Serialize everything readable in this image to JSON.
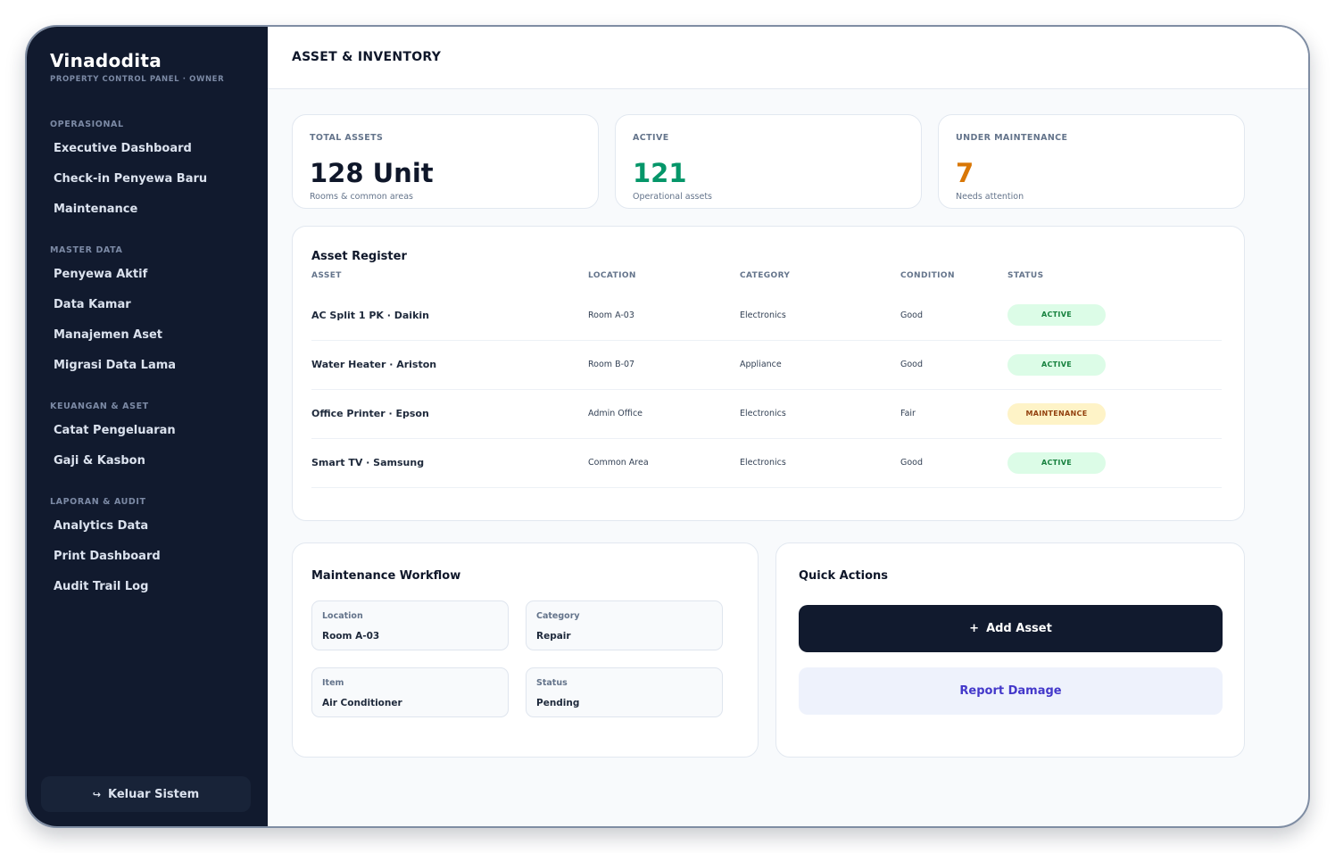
{
  "brand": {
    "title": "Vinadodita",
    "subtitle": "PROPERTY CONTROL PANEL · OWNER"
  },
  "sidebar": {
    "sections": [
      {
        "heading": "OPERASIONAL",
        "items": [
          "Executive Dashboard",
          "Check-in Penyewa Baru",
          "Maintenance"
        ]
      },
      {
        "heading": "MASTER DATA",
        "items": [
          "Penyewa Aktif",
          "Data Kamar",
          "Manajemen Aset",
          "Migrasi Data Lama"
        ]
      },
      {
        "heading": "KEUANGAN & ASET",
        "items": [
          "Catat Pengeluaran",
          "Gaji & Kasbon"
        ]
      },
      {
        "heading": "LAPORAN & AUDIT",
        "items": [
          "Analytics Data",
          "Print Dashboard",
          "Audit Trail Log"
        ]
      }
    ],
    "logout": {
      "icon": "↪",
      "label": "Keluar Sistem"
    }
  },
  "header": {
    "title": "ASSET & INVENTORY"
  },
  "stats": [
    {
      "label": "TOTAL ASSETS",
      "value": "128 Unit",
      "note": "Rooms & common areas",
      "color": "#0f172a"
    },
    {
      "label": "ACTIVE",
      "value": "121",
      "note": "Operational assets",
      "color": "#059669"
    },
    {
      "label": "UNDER MAINTENANCE",
      "value": "7",
      "note": "Needs attention",
      "color": "#d97706"
    }
  ],
  "register": {
    "title": "Asset Register",
    "columns": [
      "ASSET",
      "LOCATION",
      "CATEGORY",
      "CONDITION",
      "STATUS"
    ],
    "rows": [
      {
        "asset": "AC Split 1 PK · Daikin",
        "location": "Room A-03",
        "category": "Electronics",
        "condition": "Good",
        "status": "ACTIVE"
      },
      {
        "asset": "Water Heater · Ariston",
        "location": "Room B-07",
        "category": "Appliance",
        "condition": "Good",
        "status": "ACTIVE"
      },
      {
        "asset": "Office Printer · Epson",
        "location": "Admin Office",
        "category": "Electronics",
        "condition": "Fair",
        "status": "MAINTENANCE"
      },
      {
        "asset": "Smart TV · Samsung",
        "location": "Common Area",
        "category": "Electronics",
        "condition": "Good",
        "status": "ACTIVE"
      }
    ]
  },
  "status_colors": {
    "ACTIVE": {
      "bg": "#dcfce7",
      "fg": "#15803d"
    },
    "MAINTENANCE": {
      "bg": "#fef3c7",
      "fg": "#92400e"
    }
  },
  "workflow": {
    "title": "Maintenance Workflow",
    "fields": [
      {
        "label": "Location",
        "value": "Room A-03"
      },
      {
        "label": "Category",
        "value": "Repair"
      },
      {
        "label": "Item",
        "value": "Air Conditioner"
      },
      {
        "label": "Status",
        "value": "Pending"
      }
    ]
  },
  "quick_actions": {
    "title": "Quick Actions",
    "add": {
      "icon": "+",
      "label": "Add Asset"
    },
    "report": {
      "label": "Report Damage"
    }
  }
}
